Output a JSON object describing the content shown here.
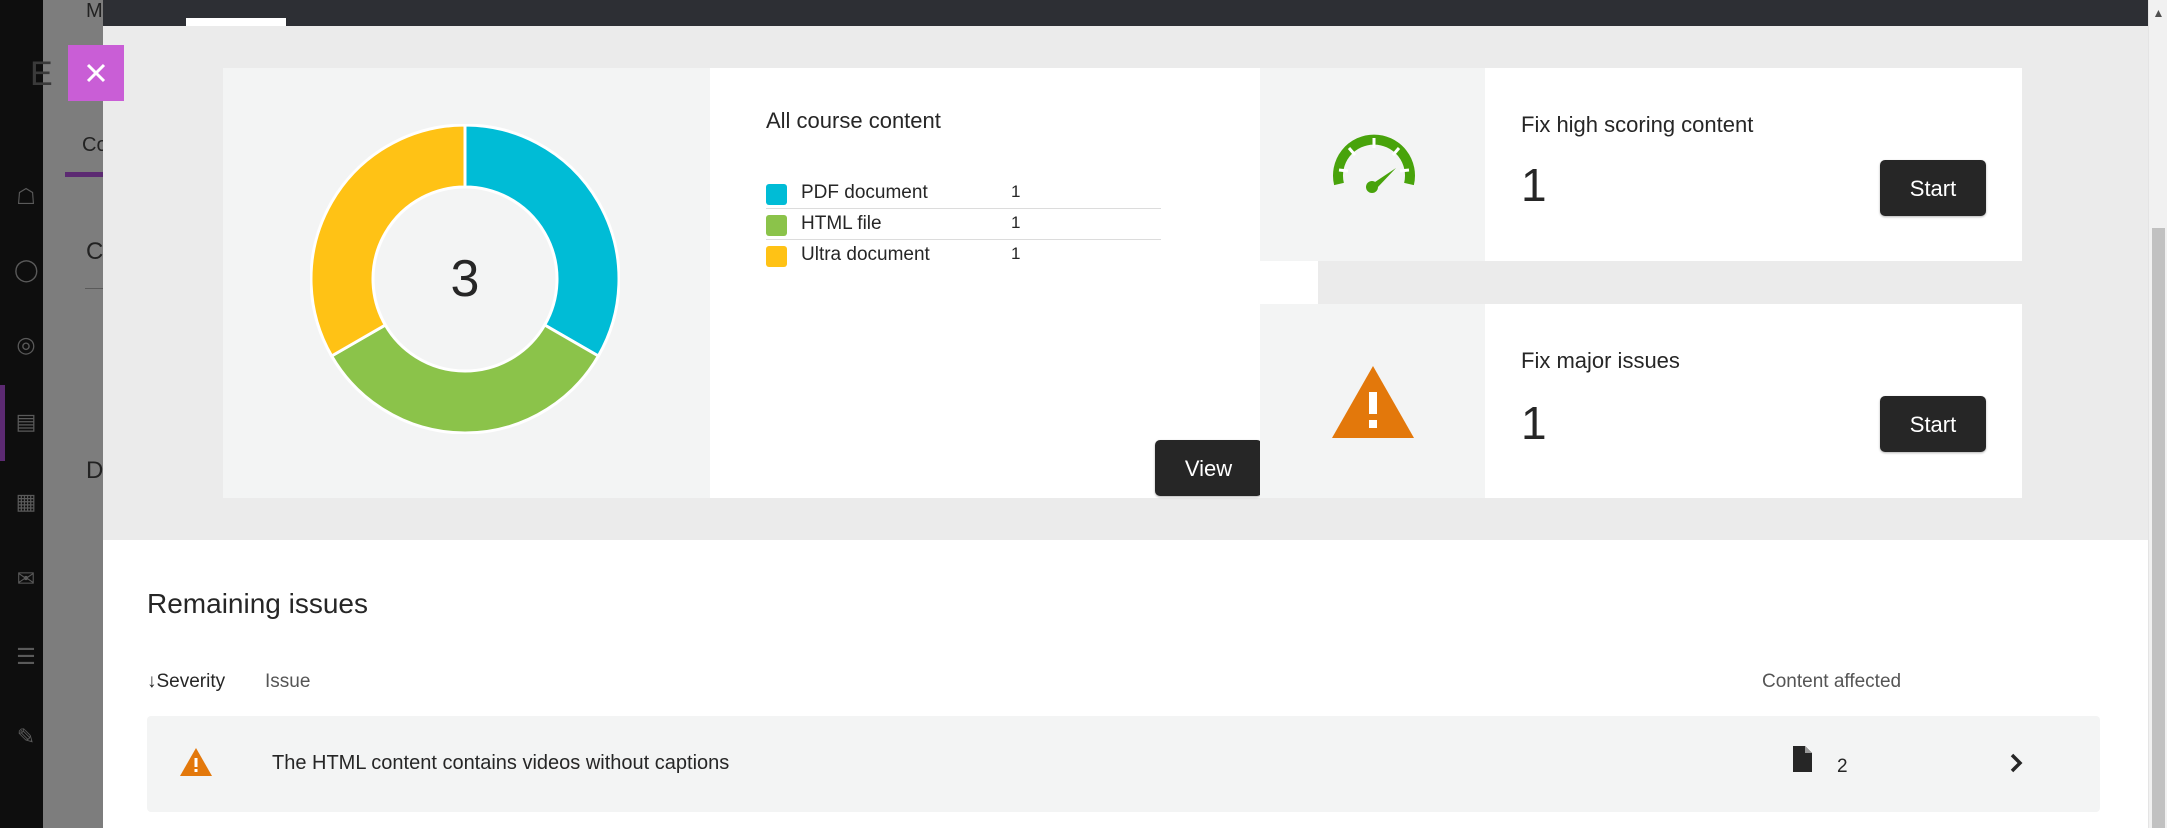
{
  "background_app": {
    "fragments": [
      "M",
      "E",
      "Co",
      "C",
      "D"
    ]
  },
  "all_content": {
    "title": "All course content",
    "total": "3",
    "items": [
      {
        "label": "PDF document",
        "count": "1",
        "color": "#00bcd6"
      },
      {
        "label": "HTML file",
        "count": "1",
        "color": "#8bc34a"
      },
      {
        "label": "Ultra document",
        "count": "1",
        "color": "#ffc215"
      }
    ],
    "view_label": "View"
  },
  "fix_high": {
    "title": "Fix high scoring content",
    "count": "1",
    "start_label": "Start",
    "icon": "gauge-icon",
    "icon_color": "#48a30b"
  },
  "fix_major": {
    "title": "Fix major issues",
    "count": "1",
    "start_label": "Start",
    "icon": "warning-icon",
    "icon_color": "#e3780b"
  },
  "remaining": {
    "title": "Remaining issues",
    "columns": {
      "severity": "Severity",
      "issue": "Issue",
      "content_affected": "Content affected"
    },
    "rows": [
      {
        "issue": "The HTML content contains videos without captions",
        "affected": "2",
        "severity_icon": "warning-icon"
      }
    ]
  },
  "colors": {
    "close_button": "#c95ed6",
    "modal_topbar": "#2d2f34",
    "dark_button": "#262626"
  }
}
